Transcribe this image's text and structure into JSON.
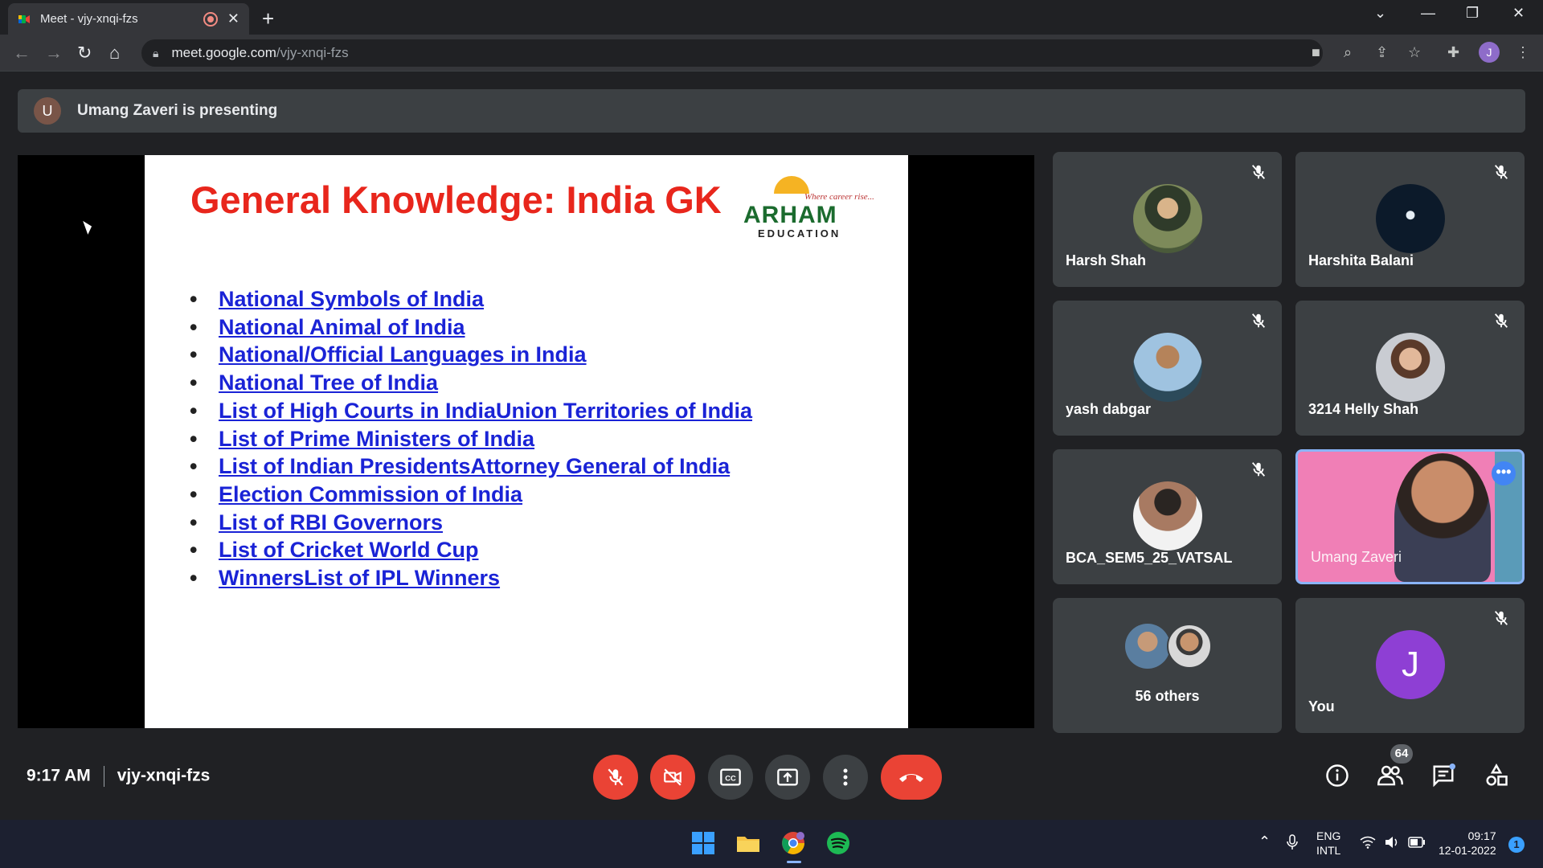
{
  "browser": {
    "tab_title": "Meet - vjy-xnqi-fzs",
    "url_host": "meet.google.com",
    "url_path": "/vjy-xnqi-fzs",
    "profile_initial": "J"
  },
  "banner": {
    "presenter_initial": "U",
    "text": "Umang Zaveri is presenting"
  },
  "slide": {
    "title": "General Knowledge: India GK",
    "logo_tagline": "Where career rise...",
    "logo_name": "ARHAM",
    "logo_sub": "EDUCATION",
    "links": [
      "National Symbols of India",
      "National Animal of India",
      "National/Official Languages in India",
      "National Tree of India",
      "List of High Courts in IndiaUnion Territories of India",
      "List of Prime Ministers of India",
      "List of Indian PresidentsAttorney General of India",
      "Election Commission of India",
      "List of RBI Governors",
      "List of Cricket World Cup",
      "WinnersList of IPL Winners"
    ]
  },
  "participants": {
    "harsh": "Harsh Shah",
    "harshita": "Harshita Balani",
    "yash": "yash dabgar",
    "helly": "3214 Helly Shah",
    "vatsal": "BCA_SEM5_25_VATSAL",
    "umang": "Umang Zaveri",
    "others": "56 others",
    "you": "You",
    "you_initial": "J"
  },
  "controls": {
    "time": "9:17 AM",
    "meeting_code": "vjy-xnqi-fzs",
    "people_count": "64"
  },
  "taskbar": {
    "lang_1": "ENG",
    "lang_2": "INTL",
    "clock_time": "09:17",
    "clock_date": "12-01-2022",
    "notif_count": "1"
  },
  "colors": {
    "accent": "#8ab4f8",
    "end_call": "#ea4335",
    "slide_title": "#e8261c",
    "link": "#1a23d6"
  }
}
